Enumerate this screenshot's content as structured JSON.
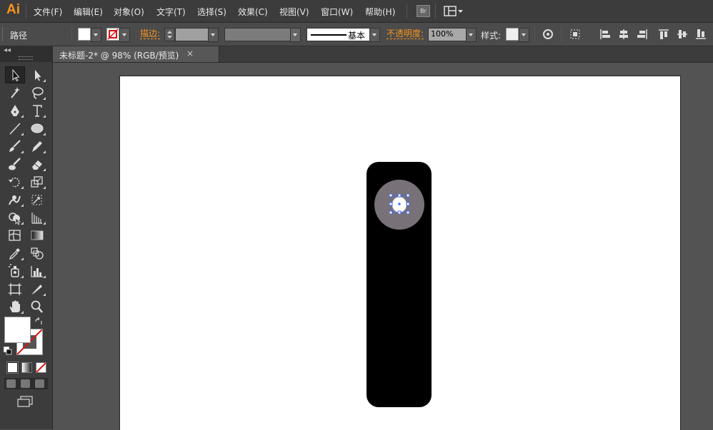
{
  "app": {
    "logo": "Ai"
  },
  "menu": [
    {
      "label": "文件(F)"
    },
    {
      "label": "编辑(E)"
    },
    {
      "label": "对象(O)"
    },
    {
      "label": "文字(T)"
    },
    {
      "label": "选择(S)"
    },
    {
      "label": "效果(C)"
    },
    {
      "label": "视图(V)"
    },
    {
      "label": "窗口(W)"
    },
    {
      "label": "帮助(H)"
    }
  ],
  "menu_extras": {
    "bridge_label": "Br",
    "workspace_icon": "layout-grid-icon"
  },
  "control_bar": {
    "selection_type": "路径",
    "fill_color": "#ffffff",
    "stroke_label": "描边:",
    "stroke_weight": "",
    "brush_profile": "基本",
    "opacity_label": "不透明度:",
    "opacity_value": "100%",
    "style_label": "样式:"
  },
  "document_tab": {
    "title": "未标题-2* @ 98% (RGB/预览)",
    "close": "×"
  },
  "colors": {
    "accent": "#f7941d",
    "ui_dark": "#3c3c3c",
    "canvas_bg": "#535353",
    "circle_fill": "#787278",
    "selection": "#3a5cff"
  },
  "tools": [
    {
      "name": "selection-tool"
    },
    {
      "name": "direct-selection-tool"
    },
    {
      "name": "magic-wand-tool"
    },
    {
      "name": "lasso-tool"
    },
    {
      "name": "pen-tool"
    },
    {
      "name": "type-tool"
    },
    {
      "name": "line-segment-tool"
    },
    {
      "name": "ellipse-tool"
    },
    {
      "name": "paintbrush-tool"
    },
    {
      "name": "pencil-tool"
    },
    {
      "name": "blob-brush-tool"
    },
    {
      "name": "eraser-tool"
    },
    {
      "name": "rotate-tool"
    },
    {
      "name": "scale-tool"
    },
    {
      "name": "warp-tool"
    },
    {
      "name": "free-transform-tool"
    },
    {
      "name": "shape-builder-tool"
    },
    {
      "name": "perspective-grid-tool"
    },
    {
      "name": "mesh-tool"
    },
    {
      "name": "gradient-tool"
    },
    {
      "name": "eyedropper-tool"
    },
    {
      "name": "blend-tool"
    },
    {
      "name": "symbol-sprayer-tool"
    },
    {
      "name": "column-graph-tool"
    },
    {
      "name": "artboard-tool"
    },
    {
      "name": "slice-tool"
    },
    {
      "name": "hand-tool"
    },
    {
      "name": "zoom-tool"
    }
  ]
}
